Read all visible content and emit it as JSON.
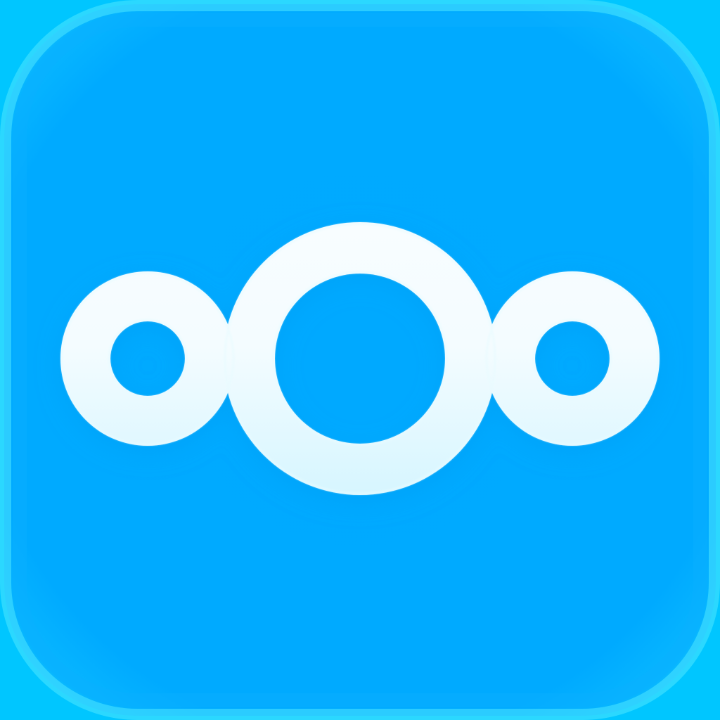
{
  "app_icon": {
    "name": "logo-icon",
    "colors": {
      "outer_glow": "#00c8ff",
      "tile_edge": "#1ab8ff",
      "tile_fill": "#00aaff",
      "ring_top": "#ffffff",
      "ring_bottom": "#a9ecff",
      "ring_highlight": "#e8fbff"
    }
  }
}
